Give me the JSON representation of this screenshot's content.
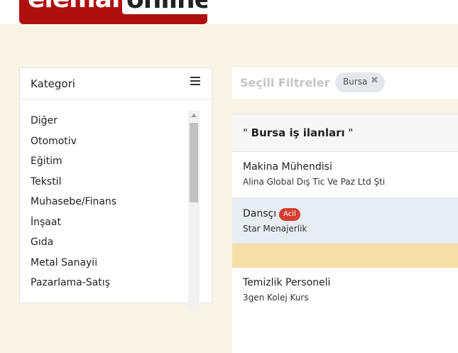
{
  "logo": {
    "word1": "eleman",
    "word2": "online"
  },
  "sidebar": {
    "title": "Kategori",
    "items": [
      {
        "label": "Diğer"
      },
      {
        "label": "Otomotiv"
      },
      {
        "label": "Eğitim"
      },
      {
        "label": "Tekstil"
      },
      {
        "label": "Muhasebe/Finans"
      },
      {
        "label": "İnşaat"
      },
      {
        "label": "Gıda"
      },
      {
        "label": "Metal Sanayii"
      },
      {
        "label": "Pazarlama-Satış"
      }
    ]
  },
  "filters": {
    "title": "Seçili Filtreler",
    "tags": [
      {
        "label": "Bursa",
        "remove": "✖"
      }
    ]
  },
  "listings": {
    "header_open": "\" ",
    "header_bold": "Bursa iş ilanları",
    "header_close": " \"",
    "jobs": [
      {
        "title": "Makina Mühendisi",
        "company": "Alina Global Dış Tic Ve Paz Ltd Şti"
      },
      {
        "title": "Dansçı",
        "badge": "Acil",
        "company": "Star Menajerlik"
      },
      {
        "title": "Temizlik Personeli",
        "company": "3gen Kolej Kurs"
      }
    ]
  },
  "colors": {
    "brand_red": "#b00f0f",
    "page_bg": "#f8f4e6",
    "badge_red": "#d43f31",
    "highlight_row": "#e7edf3",
    "yellow_band": "#f5dfa6"
  }
}
